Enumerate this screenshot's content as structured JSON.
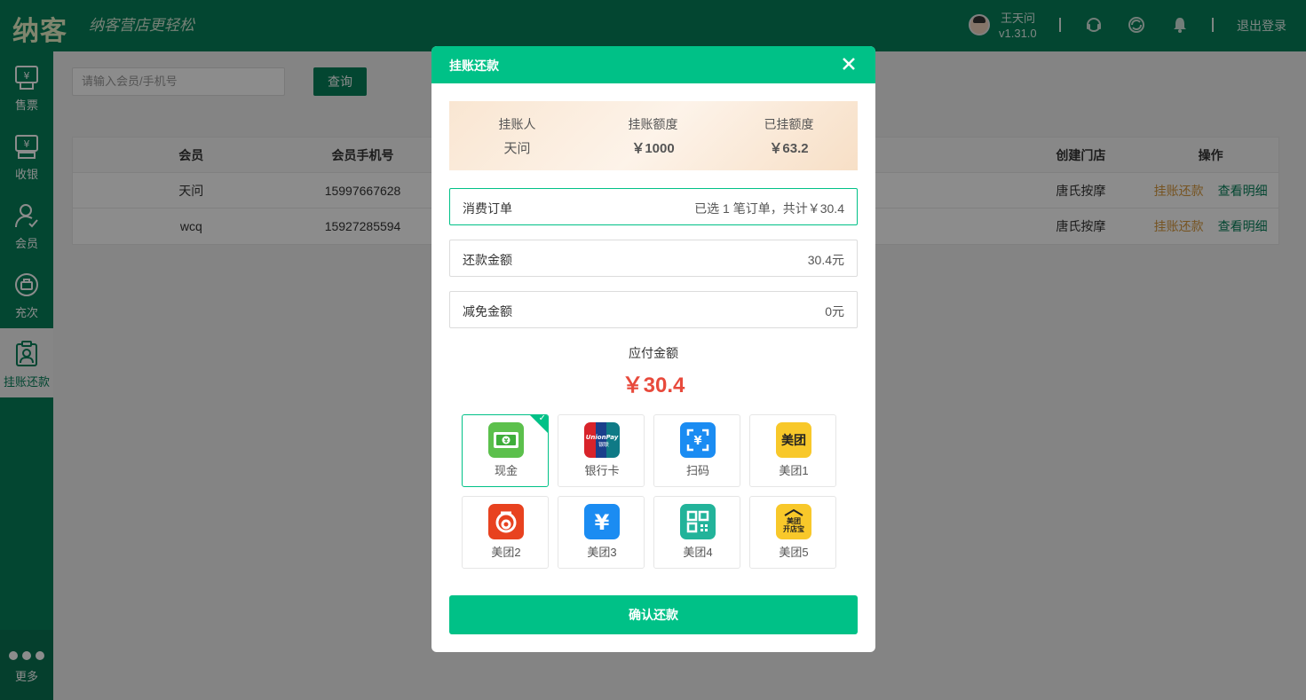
{
  "app": {
    "logo_text": "纳客",
    "slogan": "纳客营店更轻松",
    "user_name": "王天问",
    "version": "v1.31.0",
    "logout_label": "退出登录"
  },
  "sidebar": {
    "items": [
      {
        "label": "售票",
        "icon": "ticket-icon"
      },
      {
        "label": "收银",
        "icon": "cashier-icon"
      },
      {
        "label": "会员",
        "icon": "member-icon"
      },
      {
        "label": "充次",
        "icon": "recharge-icon"
      },
      {
        "label": "挂账还款",
        "icon": "credit-repay-icon",
        "active": true
      }
    ],
    "more_label": "更多"
  },
  "search": {
    "placeholder": "请输入会员/手机号",
    "button_label": "查询"
  },
  "table": {
    "headers": [
      "会员",
      "会员手机号",
      "",
      "创建门店",
      "操作"
    ],
    "rows": [
      {
        "member": "天问",
        "phone": "15997667628",
        "store": "唐氏按摩",
        "action_repay": "挂账还款",
        "action_detail": "查看明细"
      },
      {
        "member": "wcq",
        "phone": "15927285594",
        "store": "唐氏按摩",
        "action_repay": "挂账还款",
        "action_detail": "查看明细"
      }
    ]
  },
  "modal": {
    "title": "挂账还款",
    "info": {
      "holder_label": "挂账人",
      "holder_value": "天问",
      "limit_label": "挂账额度",
      "limit_value": "￥1000",
      "used_label": "已挂额度",
      "used_value": "￥63.2"
    },
    "orders": {
      "label": "消费订单",
      "value": "已选 1 笔订单，共计￥30.4"
    },
    "repay_amount": {
      "label": "还款金额",
      "value": "30.4元"
    },
    "discount_amount": {
      "label": "减免金额",
      "value": "0元"
    },
    "due_label": "应付金额",
    "due_amount": "￥30.4",
    "pay_methods": [
      {
        "label": "现金",
        "icon": "cash-icon",
        "selected": true
      },
      {
        "label": "银行卡",
        "icon": "unionpay-icon"
      },
      {
        "label": "扫码",
        "icon": "scan-code-icon"
      },
      {
        "label": "美团1",
        "icon": "meituan-icon"
      },
      {
        "label": "美团2",
        "icon": "meituan-circle-icon"
      },
      {
        "label": "美团3",
        "icon": "yuan-icon"
      },
      {
        "label": "美团4",
        "icon": "qrcode-icon"
      },
      {
        "label": "美团5",
        "icon": "meituan-store-icon"
      }
    ],
    "unionpay_text": "UnionPay",
    "unionpay_cn": "银联",
    "meituan_text": "美团",
    "meituan_store_text": "美团",
    "meituan_store_sub": "开店宝",
    "confirm_label": "确认还款"
  },
  "colors": {
    "primary": "#06805a",
    "modal_accent": "#00c187",
    "amount_red": "#e84a3c",
    "action_orange": "#d89a3e"
  }
}
